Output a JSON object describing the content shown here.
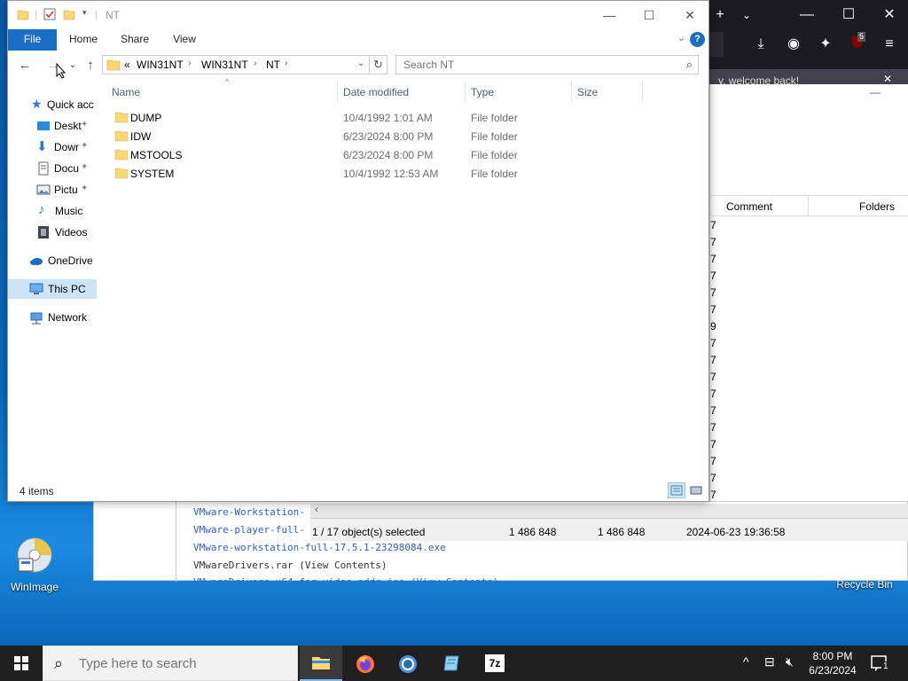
{
  "desktop": {
    "icons": [
      {
        "label": "WinImage"
      },
      {
        "label": "Recycle Bin"
      }
    ]
  },
  "firefox": {
    "notice": "y, welcome back!",
    "badge": "5"
  },
  "archive_window": {
    "columns": [
      "Comment",
      "Folders"
    ],
    "partial_digits": [
      "7",
      "7",
      "7",
      "7",
      "7",
      "7",
      "9",
      "7",
      "7",
      "7",
      "7",
      "7",
      "7",
      "7",
      "7",
      "7",
      "7"
    ]
  },
  "listing": {
    "lines": [
      "VMware-Workstation-",
      "VMware-player-full-",
      "VMware-workstation-full-17.5.1-23298084.exe",
      "VMwareDrivers.rar (View Contents)",
      "VMwareDrivers-x64-for-video-addr.iso (View Contents)"
    ]
  },
  "archive_status": {
    "selected": "1 / 17 object(s) selected",
    "size": "1 486 848",
    "packed": "1 486 848",
    "modified": "2024-06-23 19:36:58"
  },
  "explorer": {
    "title": "NT",
    "ribbon": {
      "file": "File",
      "home": "Home",
      "share": "Share",
      "view": "View",
      "help": "?"
    },
    "address": {
      "overflow": "«",
      "crumbs": [
        "WIN31NT",
        "WIN31NT",
        "NT"
      ]
    },
    "search": {
      "placeholder": "Search NT"
    },
    "nav": [
      {
        "label": "Quick acc"
      },
      {
        "label": "Deskt"
      },
      {
        "label": "Dowr"
      },
      {
        "label": "Docu"
      },
      {
        "label": "Pictu"
      },
      {
        "label": "Music"
      },
      {
        "label": "Videos"
      },
      {
        "label": "OneDrive"
      },
      {
        "label": "This PC"
      },
      {
        "label": "Network"
      }
    ],
    "columns": {
      "name": "Name",
      "date": "Date modified",
      "type": "Type",
      "size": "Size"
    },
    "rows": [
      {
        "name": "DUMP",
        "date": "10/4/1992 1:01 AM",
        "type": "File folder"
      },
      {
        "name": "IDW",
        "date": "6/23/2024 8:00 PM",
        "type": "File folder"
      },
      {
        "name": "MSTOOLS",
        "date": "6/23/2024 8:00 PM",
        "type": "File folder"
      },
      {
        "name": "SYSTEM",
        "date": "10/4/1992 12:53 AM",
        "type": "File folder"
      }
    ],
    "status": "4 items"
  },
  "taskbar": {
    "search_placeholder": "Type here to search",
    "time": "8:00 PM",
    "date": "6/23/2024",
    "notification_count": "1",
    "sevenzip_label": "7z"
  },
  "colors": {
    "accent": "#1a6fc4",
    "folder": "#f8d775",
    "taskbar": "#1f1f1f"
  }
}
